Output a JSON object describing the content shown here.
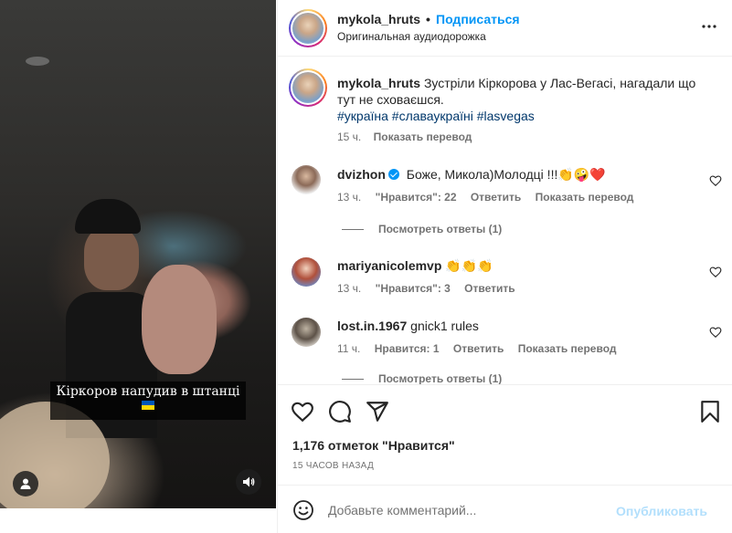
{
  "video": {
    "subtitle": "Кіркоров напудив в штанці",
    "flag_colors": [
      "#0057b7",
      "#ffd700"
    ]
  },
  "header": {
    "username": "mykola_hruts",
    "separator": "•",
    "follow_label": "Подписаться",
    "audio_label": "Оригинальная аудиодорожка"
  },
  "caption": {
    "username": "mykola_hruts",
    "text": "Зустріли Кіркорова у Лас-Вегасі, нагадали що тут не сховаєшся.",
    "hashtags": "#україна #славаукраїні #lasvegas",
    "time": "15 ч.",
    "translate_label": "Показать перевод"
  },
  "comments": [
    {
      "username": "dvizhon",
      "verified": true,
      "text": "Боже, Микола)Молодці !!!👏🤪❤️",
      "time": "13 ч.",
      "likes": "\"Нравится\": 22",
      "reply_label": "Ответить",
      "translate_label": "Показать перевод",
      "replies_label": "Посмотреть ответы (1)"
    },
    {
      "username": "mariyanicolemvp",
      "verified": false,
      "text": "👏👏👏",
      "time": "13 ч.",
      "likes": "\"Нравится\": 3",
      "reply_label": "Ответить"
    },
    {
      "username": "lost.in.1967",
      "verified": false,
      "text": "gnick1 rules",
      "time": "11 ч.",
      "likes": "Нравится: 1",
      "reply_label": "Ответить",
      "translate_label": "Показать перевод",
      "replies_label": "Посмотреть ответы (1)"
    }
  ],
  "stats": {
    "likes": "1,176 отметок \"Нравится\"",
    "posted": "15 ЧАСОВ НАЗАД"
  },
  "add_comment": {
    "placeholder": "Добавьте комментарий...",
    "publish_label": "Опубликовать"
  },
  "icons": {
    "more": "more-horizontal-icon",
    "heart": "heart-icon",
    "comment": "comment-icon",
    "share": "share-icon",
    "save": "bookmark-icon",
    "emoji": "emoji-icon",
    "audio": "speaker-icon",
    "user": "user-icon"
  },
  "colors": {
    "accent": "#0095f6",
    "publish_disabled": "#b2dffc",
    "hashtag": "#00376b",
    "secondary_text": "#737373"
  }
}
